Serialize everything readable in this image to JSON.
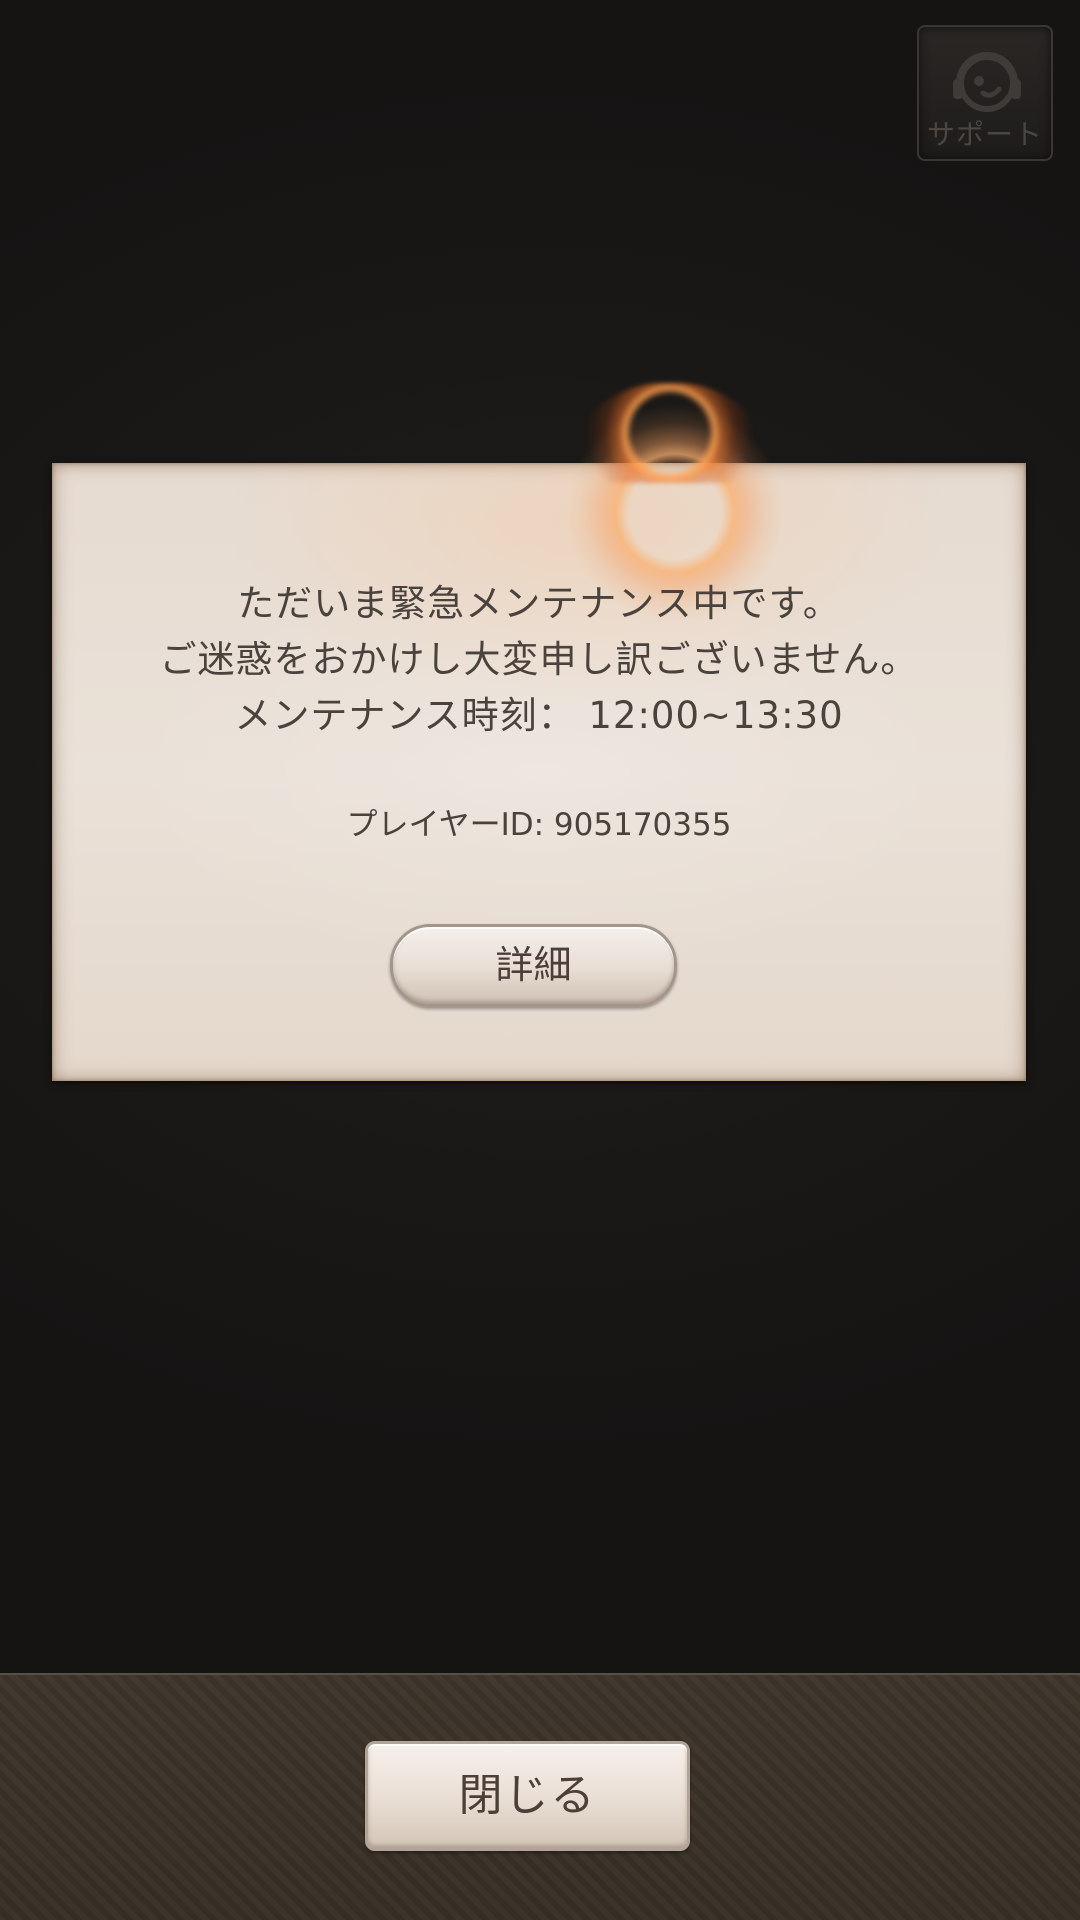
{
  "support": {
    "label": "サポート",
    "icon": "headset-support-icon"
  },
  "dialog": {
    "message_line1": "ただいま緊急メンテナンス中です。",
    "message_line2": "ご迷惑をおかけし大変申し訳ございません。",
    "message_line3": "メンテナンス時刻： 12:00~13:30",
    "player_id": "プレイヤーID: 905170355",
    "detail_button": "詳細"
  },
  "footer": {
    "close_button": "閉じる"
  },
  "colors": {
    "background": "#191715",
    "parchment": "#e8ded4",
    "text": "#4a423d",
    "bottom_bar": "#3a3128",
    "glow": "#f0a060"
  }
}
